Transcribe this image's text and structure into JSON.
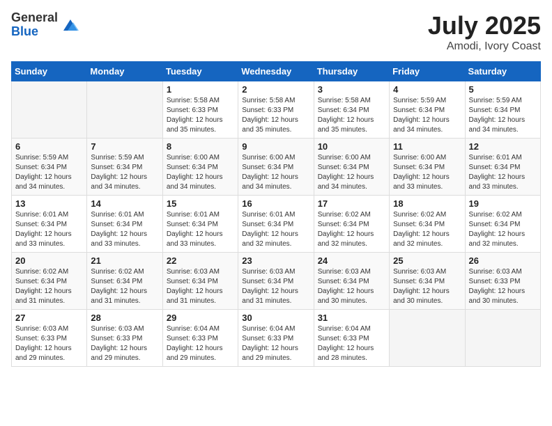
{
  "logo": {
    "general": "General",
    "blue": "Blue"
  },
  "header": {
    "month": "July 2025",
    "location": "Amodi, Ivory Coast"
  },
  "weekdays": [
    "Sunday",
    "Monday",
    "Tuesday",
    "Wednesday",
    "Thursday",
    "Friday",
    "Saturday"
  ],
  "weeks": [
    [
      {
        "day": "",
        "info": ""
      },
      {
        "day": "",
        "info": ""
      },
      {
        "day": "1",
        "info": "Sunrise: 5:58 AM\nSunset: 6:33 PM\nDaylight: 12 hours and 35 minutes."
      },
      {
        "day": "2",
        "info": "Sunrise: 5:58 AM\nSunset: 6:33 PM\nDaylight: 12 hours and 35 minutes."
      },
      {
        "day": "3",
        "info": "Sunrise: 5:58 AM\nSunset: 6:34 PM\nDaylight: 12 hours and 35 minutes."
      },
      {
        "day": "4",
        "info": "Sunrise: 5:59 AM\nSunset: 6:34 PM\nDaylight: 12 hours and 34 minutes."
      },
      {
        "day": "5",
        "info": "Sunrise: 5:59 AM\nSunset: 6:34 PM\nDaylight: 12 hours and 34 minutes."
      }
    ],
    [
      {
        "day": "6",
        "info": "Sunrise: 5:59 AM\nSunset: 6:34 PM\nDaylight: 12 hours and 34 minutes."
      },
      {
        "day": "7",
        "info": "Sunrise: 5:59 AM\nSunset: 6:34 PM\nDaylight: 12 hours and 34 minutes."
      },
      {
        "day": "8",
        "info": "Sunrise: 6:00 AM\nSunset: 6:34 PM\nDaylight: 12 hours and 34 minutes."
      },
      {
        "day": "9",
        "info": "Sunrise: 6:00 AM\nSunset: 6:34 PM\nDaylight: 12 hours and 34 minutes."
      },
      {
        "day": "10",
        "info": "Sunrise: 6:00 AM\nSunset: 6:34 PM\nDaylight: 12 hours and 34 minutes."
      },
      {
        "day": "11",
        "info": "Sunrise: 6:00 AM\nSunset: 6:34 PM\nDaylight: 12 hours and 33 minutes."
      },
      {
        "day": "12",
        "info": "Sunrise: 6:01 AM\nSunset: 6:34 PM\nDaylight: 12 hours and 33 minutes."
      }
    ],
    [
      {
        "day": "13",
        "info": "Sunrise: 6:01 AM\nSunset: 6:34 PM\nDaylight: 12 hours and 33 minutes."
      },
      {
        "day": "14",
        "info": "Sunrise: 6:01 AM\nSunset: 6:34 PM\nDaylight: 12 hours and 33 minutes."
      },
      {
        "day": "15",
        "info": "Sunrise: 6:01 AM\nSunset: 6:34 PM\nDaylight: 12 hours and 33 minutes."
      },
      {
        "day": "16",
        "info": "Sunrise: 6:01 AM\nSunset: 6:34 PM\nDaylight: 12 hours and 32 minutes."
      },
      {
        "day": "17",
        "info": "Sunrise: 6:02 AM\nSunset: 6:34 PM\nDaylight: 12 hours and 32 minutes."
      },
      {
        "day": "18",
        "info": "Sunrise: 6:02 AM\nSunset: 6:34 PM\nDaylight: 12 hours and 32 minutes."
      },
      {
        "day": "19",
        "info": "Sunrise: 6:02 AM\nSunset: 6:34 PM\nDaylight: 12 hours and 32 minutes."
      }
    ],
    [
      {
        "day": "20",
        "info": "Sunrise: 6:02 AM\nSunset: 6:34 PM\nDaylight: 12 hours and 31 minutes."
      },
      {
        "day": "21",
        "info": "Sunrise: 6:02 AM\nSunset: 6:34 PM\nDaylight: 12 hours and 31 minutes."
      },
      {
        "day": "22",
        "info": "Sunrise: 6:03 AM\nSunset: 6:34 PM\nDaylight: 12 hours and 31 minutes."
      },
      {
        "day": "23",
        "info": "Sunrise: 6:03 AM\nSunset: 6:34 PM\nDaylight: 12 hours and 31 minutes."
      },
      {
        "day": "24",
        "info": "Sunrise: 6:03 AM\nSunset: 6:34 PM\nDaylight: 12 hours and 30 minutes."
      },
      {
        "day": "25",
        "info": "Sunrise: 6:03 AM\nSunset: 6:34 PM\nDaylight: 12 hours and 30 minutes."
      },
      {
        "day": "26",
        "info": "Sunrise: 6:03 AM\nSunset: 6:33 PM\nDaylight: 12 hours and 30 minutes."
      }
    ],
    [
      {
        "day": "27",
        "info": "Sunrise: 6:03 AM\nSunset: 6:33 PM\nDaylight: 12 hours and 29 minutes."
      },
      {
        "day": "28",
        "info": "Sunrise: 6:03 AM\nSunset: 6:33 PM\nDaylight: 12 hours and 29 minutes."
      },
      {
        "day": "29",
        "info": "Sunrise: 6:04 AM\nSunset: 6:33 PM\nDaylight: 12 hours and 29 minutes."
      },
      {
        "day": "30",
        "info": "Sunrise: 6:04 AM\nSunset: 6:33 PM\nDaylight: 12 hours and 29 minutes."
      },
      {
        "day": "31",
        "info": "Sunrise: 6:04 AM\nSunset: 6:33 PM\nDaylight: 12 hours and 28 minutes."
      },
      {
        "day": "",
        "info": ""
      },
      {
        "day": "",
        "info": ""
      }
    ]
  ]
}
